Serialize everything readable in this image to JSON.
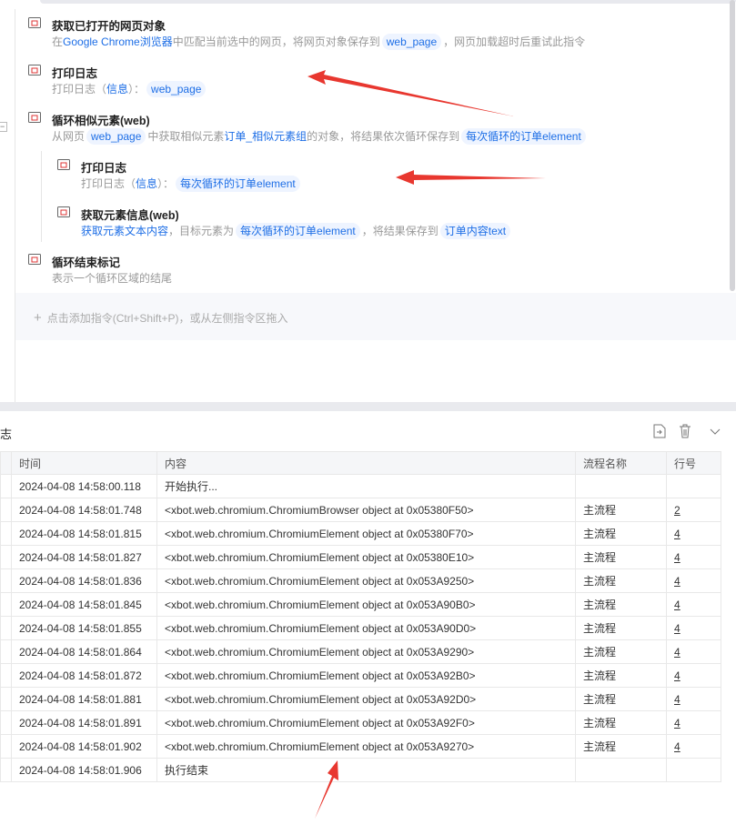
{
  "steps": [
    {
      "icon": "browser-icon",
      "title": "获取已打开的网页对象",
      "desc": [
        {
          "t": "text",
          "s": "在"
        },
        {
          "t": "link",
          "s": "Google Chrome浏览器"
        },
        {
          "t": "text",
          "s": "中匹配当前选中的网页，将网页对象保存到"
        },
        {
          "t": "chip",
          "s": "web_page"
        },
        {
          "t": "text",
          "s": "，网页加载超时后重试此指令"
        }
      ]
    },
    {
      "icon": "print-icon",
      "title": "打印日志",
      "desc": [
        {
          "t": "text",
          "s": "打印日志（"
        },
        {
          "t": "link",
          "s": "信息"
        },
        {
          "t": "text",
          "s": "）："
        },
        {
          "t": "chip",
          "s": "web_page"
        }
      ]
    },
    {
      "icon": "loop-icon",
      "title": "循环相似元素(web)",
      "desc": [
        {
          "t": "text",
          "s": "从网页"
        },
        {
          "t": "chip",
          "s": "web_page"
        },
        {
          "t": "text",
          "s": "中获取相似元素"
        },
        {
          "t": "link",
          "s": "订单_相似元素组"
        },
        {
          "t": "text",
          "s": "的对象，将结果依次循环保存到"
        },
        {
          "t": "chip",
          "s": "每次循环的订单element"
        }
      ]
    },
    {
      "icon": "print-icon",
      "title": "打印日志",
      "desc": [
        {
          "t": "text",
          "s": "打印日志（"
        },
        {
          "t": "link",
          "s": "信息"
        },
        {
          "t": "text",
          "s": "）："
        },
        {
          "t": "chip",
          "s": "每次循环的订单element"
        }
      ]
    },
    {
      "icon": "element-info-icon",
      "title": "获取元素信息(web)",
      "desc": [
        {
          "t": "link",
          "s": "获取元素文本内容"
        },
        {
          "t": "text",
          "s": "，目标元素为"
        },
        {
          "t": "chip",
          "s": "每次循环的订单element"
        },
        {
          "t": "text",
          "s": "，将结果保存到"
        },
        {
          "t": "chip",
          "s": "订单内容text"
        }
      ]
    },
    {
      "icon": "loop-end-icon",
      "title": "循环结束标记",
      "desc": [
        {
          "t": "text",
          "s": "表示一个循环区域的结尾"
        }
      ]
    }
  ],
  "add_hint": "点击添加指令(Ctrl+Shift+P)，或从左侧指令区拖入",
  "log": {
    "title": "志",
    "columns": [
      "时间",
      "内容",
      "流程名称",
      "行号"
    ],
    "rows": [
      [
        "2024-04-08 14:58:00.118",
        "开始执行...",
        "",
        ""
      ],
      [
        "2024-04-08 14:58:01.748",
        "<xbot.web.chromium.ChromiumBrowser object at 0x05380F50>",
        "主流程",
        "2"
      ],
      [
        "2024-04-08 14:58:01.815",
        "<xbot.web.chromium.ChromiumElement object at 0x05380F70>",
        "主流程",
        "4"
      ],
      [
        "2024-04-08 14:58:01.827",
        "<xbot.web.chromium.ChromiumElement object at 0x05380E10>",
        "主流程",
        "4"
      ],
      [
        "2024-04-08 14:58:01.836",
        "<xbot.web.chromium.ChromiumElement object at 0x053A9250>",
        "主流程",
        "4"
      ],
      [
        "2024-04-08 14:58:01.845",
        "<xbot.web.chromium.ChromiumElement object at 0x053A90B0>",
        "主流程",
        "4"
      ],
      [
        "2024-04-08 14:58:01.855",
        "<xbot.web.chromium.ChromiumElement object at 0x053A90D0>",
        "主流程",
        "4"
      ],
      [
        "2024-04-08 14:58:01.864",
        "<xbot.web.chromium.ChromiumElement object at 0x053A9290>",
        "主流程",
        "4"
      ],
      [
        "2024-04-08 14:58:01.872",
        "<xbot.web.chromium.ChromiumElement object at 0x053A92B0>",
        "主流程",
        "4"
      ],
      [
        "2024-04-08 14:58:01.881",
        "<xbot.web.chromium.ChromiumElement object at 0x053A92D0>",
        "主流程",
        "4"
      ],
      [
        "2024-04-08 14:58:01.891",
        "<xbot.web.chromium.ChromiumElement object at 0x053A92F0>",
        "主流程",
        "4"
      ],
      [
        "2024-04-08 14:58:01.902",
        "<xbot.web.chromium.ChromiumElement object at 0x053A9270>",
        "主流程",
        "4"
      ],
      [
        "2024-04-08 14:58:01.906",
        "执行结束",
        "",
        ""
      ]
    ]
  },
  "colors": {
    "accent": "#1d6ee6",
    "annotation": "#e8372f"
  }
}
